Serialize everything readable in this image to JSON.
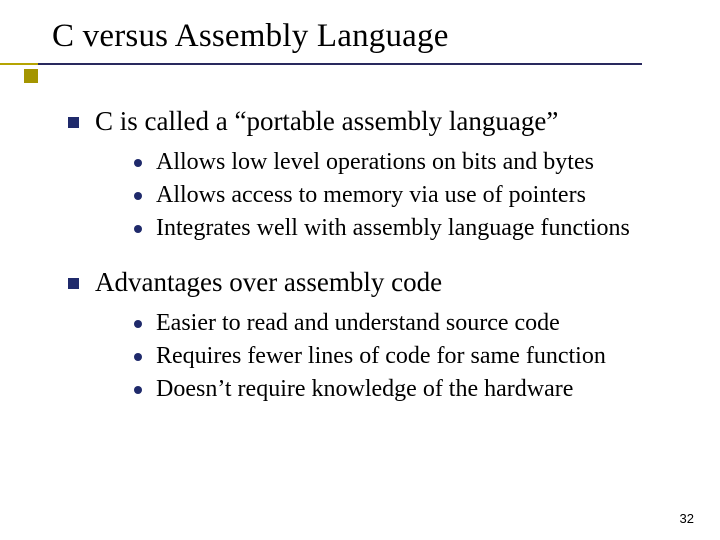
{
  "title": "C versus Assembly Language",
  "sections": [
    {
      "heading": "C is called a “portable assembly language”",
      "items": [
        "Allows low level operations on bits and bytes",
        "Allows access to memory via use of pointers",
        "Integrates well with assembly language functions"
      ]
    },
    {
      "heading": "Advantages over assembly code",
      "items": [
        "Easier to read and understand source code",
        "Requires fewer lines of code for same function",
        "Doesn’t require knowledge of the hardware"
      ]
    }
  ],
  "page_number": "32"
}
